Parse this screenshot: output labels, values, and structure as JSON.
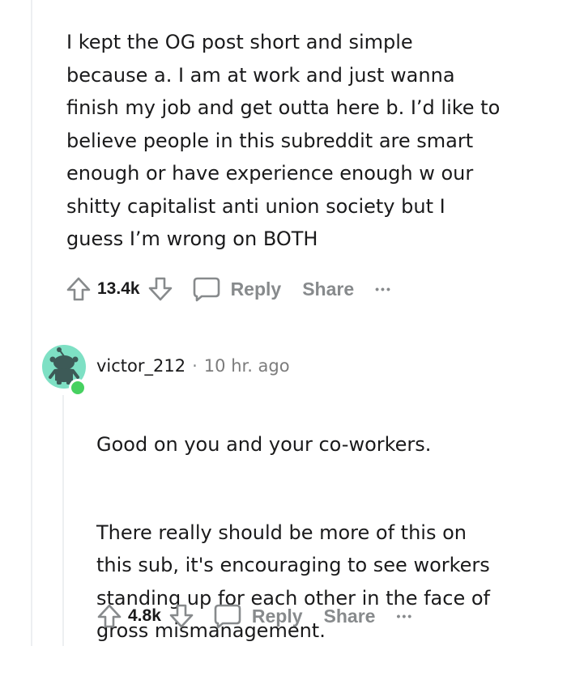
{
  "parent_comment": {
    "body": "I kept the OG post short and simple\nbecause a. I am at work and just wanna\nfinish my job and get outta here b. I’d like to\nbelieve people in this subreddit are smart\nenough or have experience enough w our\nshitty capitalist anti union society but I\nguess I’m wrong on BOTH",
    "votes": "13.4k",
    "reply_label": "Reply",
    "share_label": "Share",
    "more_label": "•••"
  },
  "reply_comment": {
    "username": "victor_212",
    "separator": "·",
    "time": "10 hr. ago",
    "paragraphs": [
      "Good on you and your co-workers.",
      "There really should be more of this on\nthis sub, it's encouraging to see workers\nstanding up for each other in the face of\ngross mismanagement."
    ],
    "votes": "4.8k",
    "reply_label": "Reply",
    "share_label": "Share",
    "more_label": "•••"
  },
  "colors": {
    "text": "#1a1a1b",
    "muted": "#878a8c",
    "avatar_bg": "#7ee0c4",
    "avatar_figure": "#3d5a57",
    "online": "#46d160",
    "thread_line": "#edeff1"
  },
  "icons": {
    "upvote": "arrow-up-icon",
    "downvote": "arrow-down-icon",
    "reply": "comment-bubble-icon",
    "more": "more-dots-icon",
    "avatar": "snoo-avatar-icon"
  }
}
